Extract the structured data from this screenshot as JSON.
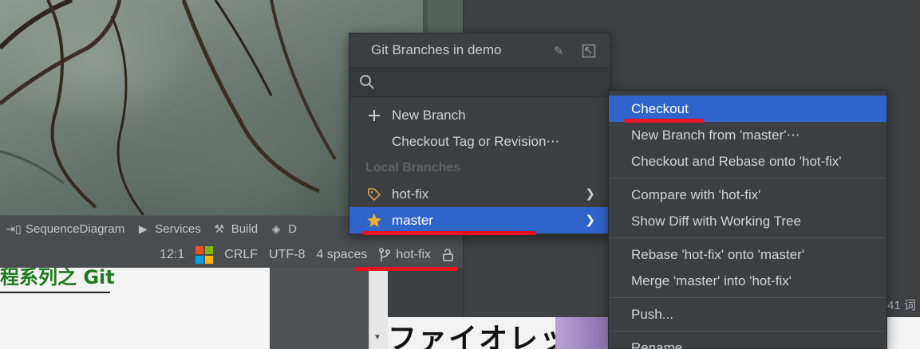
{
  "toolwindow_bar": {
    "items": [
      {
        "icon": "sequence-diagram-icon",
        "label": "SequenceDiagram"
      },
      {
        "icon": "services-icon",
        "label": "Services"
      },
      {
        "icon": "build-icon",
        "label": "Build"
      },
      {
        "icon": "layers-icon",
        "label": "D"
      }
    ]
  },
  "status_bar": {
    "position": "12:1",
    "line_ending": "CRLF",
    "encoding": "UTF-8",
    "indent": "4 spaces",
    "branch": "hot-fix"
  },
  "document": {
    "title_fragment": "程系列之 Git",
    "manga_text": "ファイオレット",
    "word_count": "41 词"
  },
  "git_popup": {
    "title": "Git Branches in demo",
    "search_placeholder": "",
    "actions": [
      {
        "icon": "plus-icon",
        "label": "New Branch"
      },
      {
        "icon": "",
        "label": "Checkout Tag or Revision⋯"
      }
    ],
    "section_label": "Local Branches",
    "branches": [
      {
        "icon": "tag-icon",
        "label": "hot-fix",
        "selected": false
      },
      {
        "icon": "star-icon",
        "label": "master",
        "selected": true
      }
    ]
  },
  "branch_menu": {
    "groups": [
      [
        {
          "label": "Checkout",
          "selected": true
        },
        {
          "label": "New Branch from 'master'⋯",
          "selected": false
        },
        {
          "label": "Checkout and Rebase onto 'hot-fix'",
          "selected": false
        }
      ],
      [
        {
          "label": "Compare with 'hot-fix'",
          "selected": false
        },
        {
          "label": "Show Diff with Working Tree",
          "selected": false
        }
      ],
      [
        {
          "label": "Rebase 'hot-fix' onto 'master'",
          "selected": false
        },
        {
          "label": "Merge 'master' into 'hot-fix'",
          "selected": false
        }
      ],
      [
        {
          "label": "Push...",
          "selected": false
        }
      ],
      [
        {
          "label": "Rename...",
          "selected": false
        }
      ]
    ]
  },
  "colors": {
    "selection": "#2f65ca",
    "annotation_red": "#e5141e",
    "popup_bg": "#3c3f41"
  }
}
